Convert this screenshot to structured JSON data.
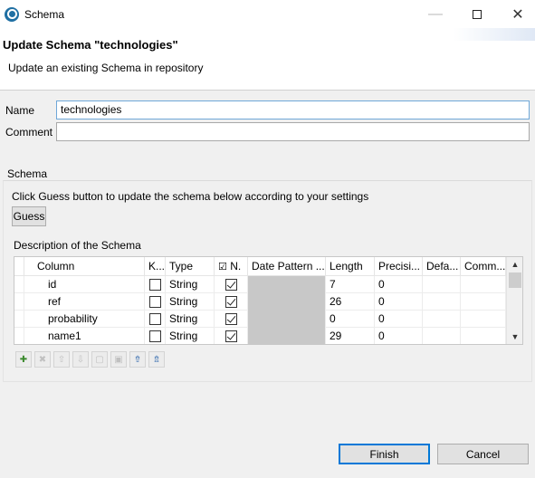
{
  "window": {
    "title": "Schema"
  },
  "header": {
    "title": "Update Schema \"technologies\"",
    "subtitle": "Update an existing Schema in repository"
  },
  "form": {
    "name_label": "Name",
    "name_value": "technologies",
    "comment_label": "Comment",
    "comment_value": ""
  },
  "schema": {
    "group_label": "Schema",
    "guess_hint": "Click Guess button to update the schema below according to your settings",
    "guess_button": "Guess",
    "description_label": "Description of the Schema",
    "columns": [
      "Column",
      "K...",
      "Type",
      "N.",
      "Date Pattern ...",
      "Length",
      "Precisi...",
      "Defa...",
      "Comm..."
    ],
    "rows": [
      {
        "column": "id",
        "key": false,
        "type": "String",
        "nullable": true,
        "date_pattern": "",
        "length": "7",
        "precision": "0",
        "default": "",
        "comment": ""
      },
      {
        "column": "ref",
        "key": false,
        "type": "String",
        "nullable": true,
        "date_pattern": "",
        "length": "26",
        "precision": "0",
        "default": "",
        "comment": ""
      },
      {
        "column": "probability",
        "key": false,
        "type": "String",
        "nullable": true,
        "date_pattern": "",
        "length": "0",
        "precision": "0",
        "default": "",
        "comment": ""
      },
      {
        "column": "name1",
        "key": false,
        "type": "String",
        "nullable": true,
        "date_pattern": "",
        "length": "29",
        "precision": "0",
        "default": "",
        "comment": ""
      }
    ],
    "toolbar_icons": [
      "add-icon",
      "delete-icon",
      "move-up-icon",
      "move-down-icon",
      "copy-icon",
      "paste-icon",
      "import-icon",
      "export-icon"
    ]
  },
  "footer": {
    "finish_label": "Finish",
    "cancel_label": "Cancel"
  }
}
